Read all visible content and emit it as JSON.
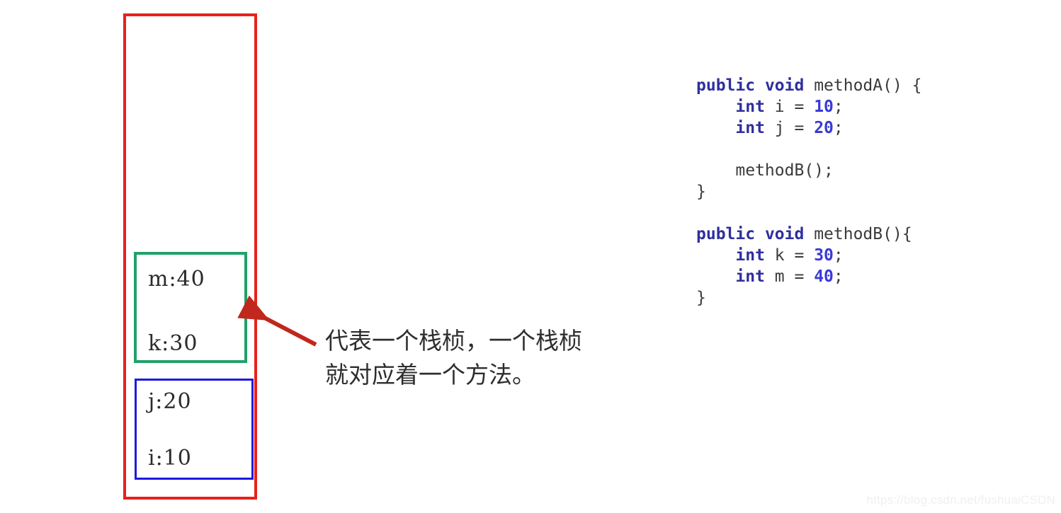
{
  "diagram": {
    "outer_box_label": "call-stack",
    "outer_box_color": "#e8211c",
    "frames": [
      {
        "name": "methodB-frame",
        "border_color": "#23a06a",
        "variables": [
          "m:40",
          "k:30"
        ]
      },
      {
        "name": "methodA-frame",
        "border_color": "#1a1ae0",
        "variables": [
          "j:20",
          "i:10"
        ]
      }
    ]
  },
  "annotation": {
    "text": "代表一个栈桢，一个栈桢\n就对应着一个方法。",
    "arrow_color": "#c0271d",
    "arrow_icon": "arrow-up-left-icon"
  },
  "code": {
    "lines": [
      [
        {
          "t": "public",
          "k": "kw"
        },
        {
          "t": " ",
          "k": "plain"
        },
        {
          "t": "void",
          "k": "kw"
        },
        {
          "t": " methodA() {",
          "k": "plain"
        }
      ],
      [
        {
          "t": "    ",
          "k": "plain"
        },
        {
          "t": "int",
          "k": "kw"
        },
        {
          "t": " i = ",
          "k": "plain"
        },
        {
          "t": "10",
          "k": "num"
        },
        {
          "t": ";",
          "k": "plain"
        }
      ],
      [
        {
          "t": "    ",
          "k": "plain"
        },
        {
          "t": "int",
          "k": "kw"
        },
        {
          "t": " j = ",
          "k": "plain"
        },
        {
          "t": "20",
          "k": "num"
        },
        {
          "t": ";",
          "k": "plain"
        }
      ],
      [],
      [
        {
          "t": "    methodB();",
          "k": "plain"
        }
      ],
      [
        {
          "t": "}",
          "k": "plain"
        }
      ],
      [],
      [
        {
          "t": "public",
          "k": "kw"
        },
        {
          "t": " ",
          "k": "plain"
        },
        {
          "t": "void",
          "k": "kw"
        },
        {
          "t": " methodB(){",
          "k": "plain"
        }
      ],
      [
        {
          "t": "    ",
          "k": "plain"
        },
        {
          "t": "int",
          "k": "kw"
        },
        {
          "t": " k = ",
          "k": "plain"
        },
        {
          "t": "30",
          "k": "num"
        },
        {
          "t": ";",
          "k": "plain"
        }
      ],
      [
        {
          "t": "    ",
          "k": "plain"
        },
        {
          "t": "int",
          "k": "kw"
        },
        {
          "t": " m = ",
          "k": "plain"
        },
        {
          "t": "40",
          "k": "num"
        },
        {
          "t": ";",
          "k": "plain"
        }
      ],
      [
        {
          "t": "}",
          "k": "plain"
        }
      ]
    ]
  },
  "watermark": {
    "text": "https://blog.csdn.net/fushuaiCSDN"
  }
}
